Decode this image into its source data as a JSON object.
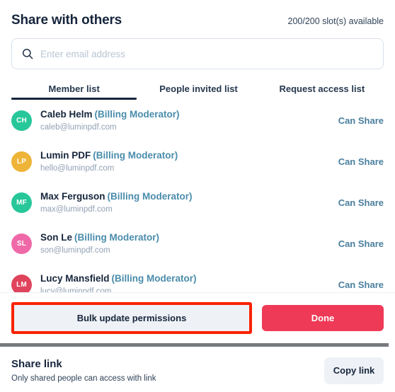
{
  "header": {
    "title": "Share with others",
    "slots_text": "200/200 slot(s) available"
  },
  "search": {
    "placeholder": "Enter email address",
    "value": "",
    "icon": "search-icon"
  },
  "tabs": [
    {
      "label": "Member list",
      "active": true
    },
    {
      "label": "People invited list",
      "active": false
    },
    {
      "label": "Request access list",
      "active": false
    }
  ],
  "members": [
    {
      "initials": "CH",
      "avatar_color": "#28c79a",
      "name": "Caleb Helm",
      "role": "(Billing Moderator)",
      "email": "caleb@luminpdf.com",
      "permission": "Can Share"
    },
    {
      "initials": "LP",
      "avatar_color": "#eeb437",
      "name": "Lumin PDF",
      "role": "(Billing Moderator)",
      "email": "hello@luminpdf.com",
      "permission": "Can Share"
    },
    {
      "initials": "MF",
      "avatar_color": "#28c79a",
      "name": "Max Ferguson",
      "role": "(Billing Moderator)",
      "email": "max@luminpdf.com",
      "permission": "Can Share"
    },
    {
      "initials": "SL",
      "avatar_color": "#ef69a8",
      "name": "Son Le",
      "role": "(Billing Moderator)",
      "email": "son@luminpdf.com",
      "permission": "Can Share"
    },
    {
      "initials": "LM",
      "avatar_color": "#e0445c",
      "name": "Lucy Mansfield",
      "role": "(Billing Moderator)",
      "email": "lucy@luminpdf.com",
      "permission": "Can Share"
    }
  ],
  "actions": {
    "bulk_update_label": "Bulk update permissions",
    "done_label": "Done",
    "highlight_color": "#fb2200"
  },
  "share_link": {
    "title": "Share link",
    "subtitle": "Only shared people can access with link",
    "copy_label": "Copy link"
  },
  "colors": {
    "primary_text": "#16253c",
    "accent_red": "#ef3a57",
    "permission_blue": "#4a7f9e",
    "role_blue": "#4a8cab"
  }
}
